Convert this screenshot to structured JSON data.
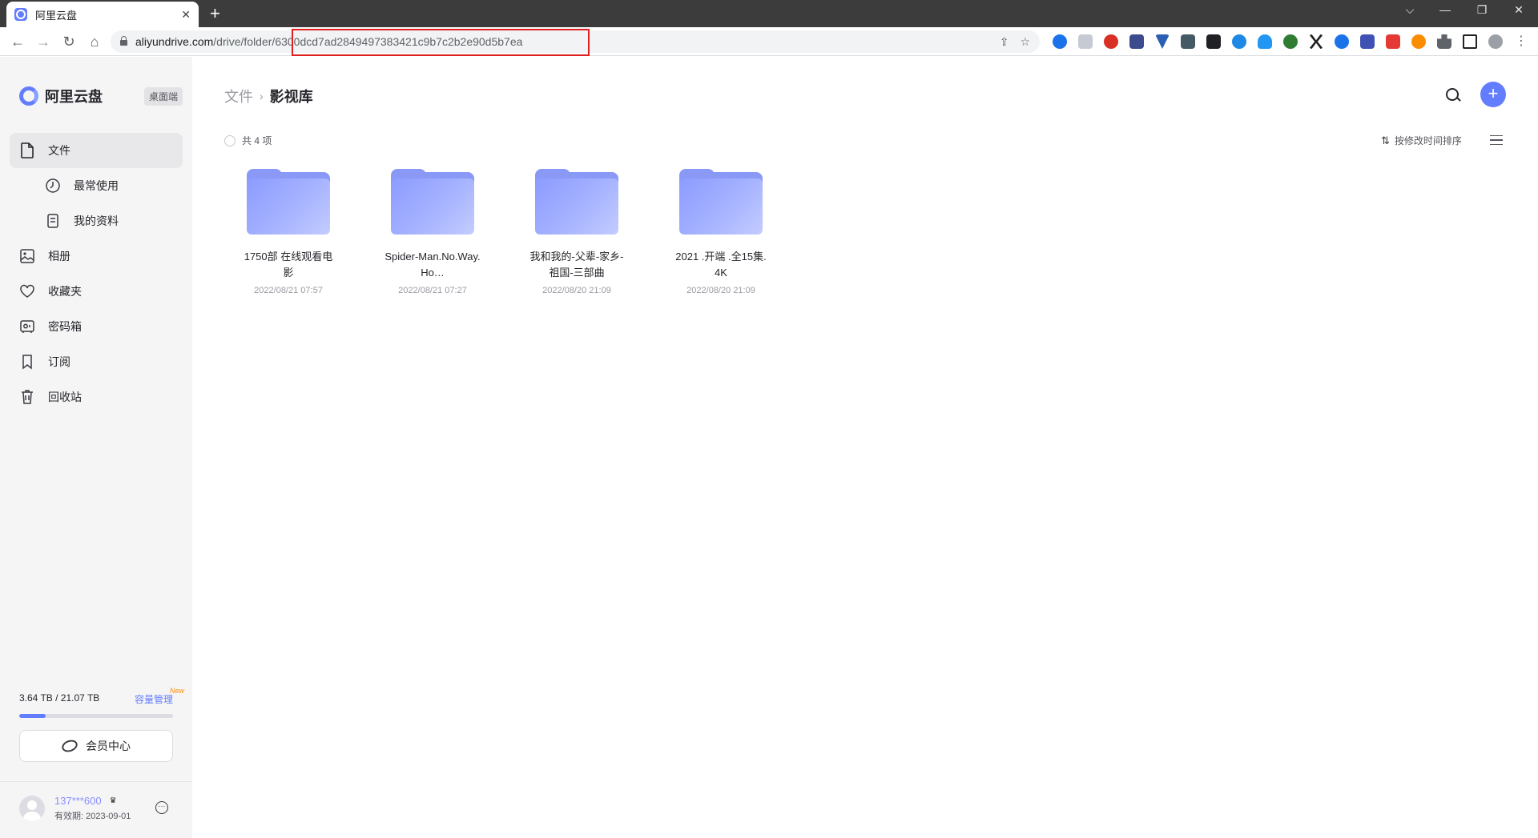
{
  "browser": {
    "tab_title": "阿里云盘",
    "tab_close": "✕",
    "new_tab": "+",
    "url_host": "aliyundrive.com",
    "url_path": "/drive/folder/",
    "url_id": "6300dcd7ad2849497383421c9b7c2b2e90d5b7ea",
    "highlight_color": "#e02020"
  },
  "app": {
    "logo_text": "阿里云盘",
    "desktop_badge": "桌面端",
    "accent_color": "#637dff"
  },
  "sidebar": {
    "items": [
      {
        "label": "文件",
        "icon": "file-icon"
      },
      {
        "label": "最常使用",
        "icon": "clock-icon"
      },
      {
        "label": "我的资料",
        "icon": "document-icon"
      },
      {
        "label": "相册",
        "icon": "photo-icon"
      },
      {
        "label": "收藏夹",
        "icon": "heart-icon"
      },
      {
        "label": "密码箱",
        "icon": "safe-icon"
      },
      {
        "label": "订阅",
        "icon": "bookmark-icon"
      },
      {
        "label": "回收站",
        "icon": "trash-icon"
      }
    ],
    "storage": {
      "used_text": "3.64 TB / 21.07 TB",
      "manage_label": "容量管理",
      "new_badge": "New",
      "used_fraction": 0.17
    },
    "member_label": "会员中心",
    "user": {
      "name": "137***600",
      "expiry": "有效期: 2023-09-01"
    }
  },
  "main": {
    "breadcrumb_root": "文件",
    "breadcrumb_current": "影视库",
    "count_label": "共 4 项",
    "sort_label": "按修改时间排序",
    "files": [
      {
        "name": "1750部 在线观看电影",
        "date": "2022/08/21 07:57"
      },
      {
        "name": "Spider-Man.No.Way.Ho…",
        "date": "2022/08/21 07:27"
      },
      {
        "name": "我和我的-父辈-家乡-祖国-三部曲",
        "date": "2022/08/20 21:09"
      },
      {
        "name": "2021 .开端 .全15集. 4K",
        "date": "2022/08/20 21:09"
      }
    ]
  }
}
